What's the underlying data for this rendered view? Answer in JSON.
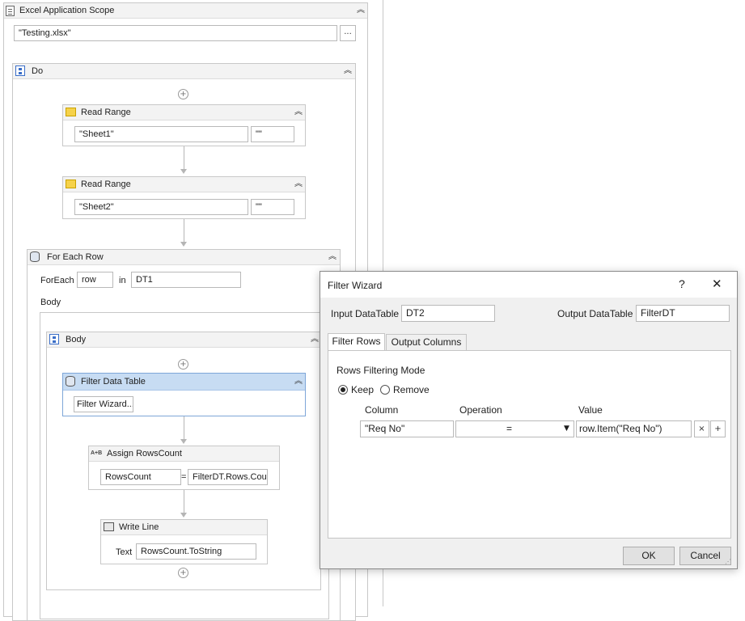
{
  "excel_scope": {
    "title": "Excel Application Scope",
    "file_path": "\"Testing.xlsx\"",
    "browse_label": "..."
  },
  "do_sequence": {
    "title": "Do"
  },
  "read_range_1": {
    "title": "Read Range",
    "sheet": "\"Sheet1\"",
    "range": "\"\""
  },
  "read_range_2": {
    "title": "Read Range",
    "sheet": "\"Sheet2\"",
    "range": "\"\""
  },
  "for_each_row": {
    "title": "For Each Row",
    "foreach_label": "ForEach",
    "item_var": "row",
    "in_label": "in",
    "collection": "DT1",
    "body_label": "Body"
  },
  "body_sequence": {
    "title": "Body"
  },
  "filter_data_table": {
    "title": "Filter Data Table",
    "button_label": "Filter Wizard..."
  },
  "assign": {
    "title": "Assign RowsCount",
    "to": "RowsCount",
    "equals": "=",
    "value": "FilterDT.Rows.Cour"
  },
  "write_line": {
    "title": "Write Line",
    "text_label": "Text",
    "text_value": "RowsCount.ToString"
  },
  "icons": {
    "collapse": "double-chevron-up-icon",
    "add": "plus-circle-icon"
  },
  "filter_wizard": {
    "title": "Filter Wizard",
    "help": "?",
    "close": "✕",
    "input_label": "Input DataTable",
    "input_value": "DT2",
    "output_label": "Output DataTable",
    "output_value": "FilterDT",
    "tabs": [
      "Filter Rows",
      "Output Columns"
    ],
    "mode_label": "Rows Filtering Mode",
    "keep_label": "Keep",
    "remove_label": "Remove",
    "columns": {
      "column": "Column",
      "operation": "Operation",
      "value": "Value"
    },
    "row": {
      "column": "\"Req No\"",
      "operation": "=",
      "value": "row.Item(\"Req No\")",
      "remove_btn": "×",
      "add_btn": "+"
    },
    "ok_label": "OK",
    "cancel_label": "Cancel"
  }
}
